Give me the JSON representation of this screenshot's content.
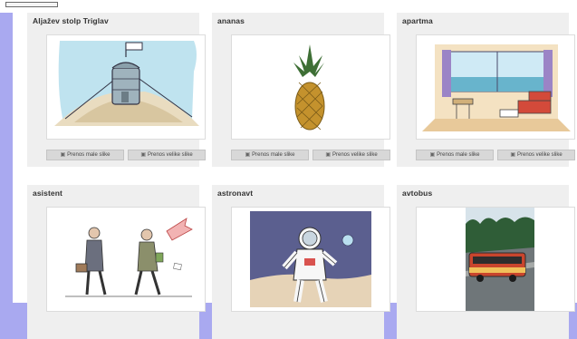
{
  "top_chip_text": "",
  "cards": [
    {
      "title": "Aljažev stolp Triglav",
      "icon": "aljazev-stolp-illustration"
    },
    {
      "title": "ananas",
      "icon": "pineapple-illustration"
    },
    {
      "title": "apartma",
      "icon": "apartment-room-illustration"
    },
    {
      "title": "asistent",
      "icon": "assistant-illustration"
    },
    {
      "title": "astronavt",
      "icon": "astronaut-illustration"
    },
    {
      "title": "avtobus",
      "icon": "bus-photo"
    }
  ],
  "buttons": {
    "small": "Prenos male slike",
    "large": "Prenos velike slike"
  }
}
